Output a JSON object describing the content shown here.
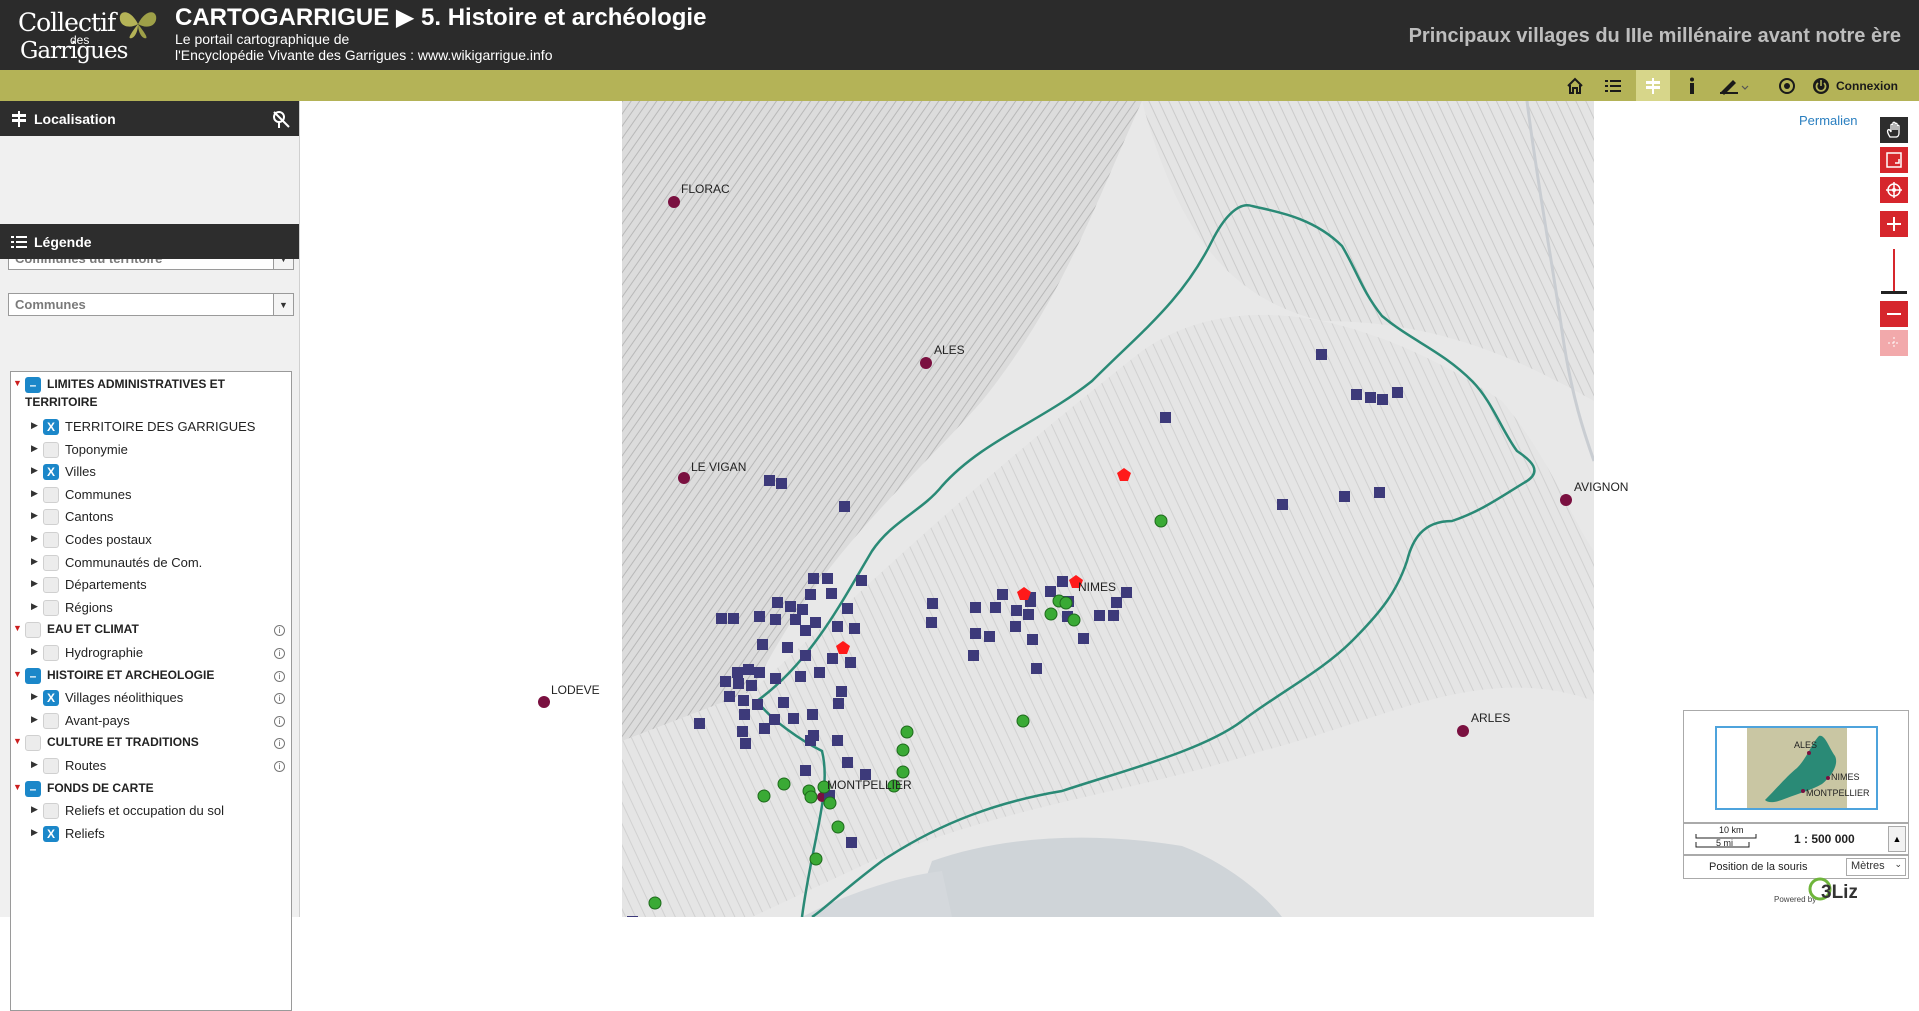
{
  "header": {
    "logo_line1": "Collectif",
    "logo_line2": "des",
    "logo_line3": "Garrigues",
    "title": "CARTOGARRIGUE ▶ 5. Histoire et archéologie",
    "subtitle1": "Le portail cartographique de",
    "subtitle2": "l'Encyclopédie Vivante des Garrigues : www.wikigarrigue.info",
    "map_title": "Principaux villages du IIIe millénaire avant notre ère"
  },
  "toolbar": {
    "connexion_label": "Connexion"
  },
  "localisation": {
    "title": "Localisation",
    "combo1": "Communes du territoire",
    "combo2": "Communes"
  },
  "legend": {
    "title": "Légende",
    "items": [
      {
        "label": "LIMITES ADMINISTRATIVES ET",
        "label2": "TERRITOIRE",
        "type": "group",
        "state": "minus"
      },
      {
        "label": "TERRITOIRE DES GARRIGUES",
        "type": "layer",
        "state": "x"
      },
      {
        "label": "Toponymie",
        "type": "layer",
        "state": "empty"
      },
      {
        "label": "Villes",
        "type": "layer",
        "state": "x"
      },
      {
        "label": "Communes",
        "type": "layer",
        "state": "empty"
      },
      {
        "label": "Cantons",
        "type": "layer",
        "state": "empty"
      },
      {
        "label": "Codes postaux",
        "type": "layer",
        "state": "empty"
      },
      {
        "label": "Communautés de Com.",
        "type": "layer",
        "state": "empty"
      },
      {
        "label": "Départements",
        "type": "layer",
        "state": "empty"
      },
      {
        "label": "Régions",
        "type": "layer",
        "state": "empty"
      },
      {
        "label": "EAU ET CLIMAT",
        "type": "group",
        "state": "empty"
      },
      {
        "label": "Hydrographie",
        "type": "layer",
        "state": "empty"
      },
      {
        "label": "HISTOIRE ET ARCHEOLOGIE",
        "type": "group",
        "state": "minus"
      },
      {
        "label": "Villages néolithiques",
        "type": "layer",
        "state": "x"
      },
      {
        "label": "Avant-pays",
        "type": "layer",
        "state": "empty"
      },
      {
        "label": "CULTURE ET TRADITIONS",
        "type": "group",
        "state": "empty"
      },
      {
        "label": "Routes",
        "type": "layer",
        "state": "empty"
      },
      {
        "label": "FONDS DE CARTE",
        "type": "group",
        "state": "minus"
      },
      {
        "label": "Reliefs et occupation du sol",
        "type": "layer",
        "state": "empty"
      },
      {
        "label": "Reliefs",
        "type": "layer",
        "state": "x"
      }
    ]
  },
  "map": {
    "permalien": "Permalien",
    "cities": {
      "florac": "FLORAC",
      "ales": "ALES",
      "le_vigan": "LE VIGAN",
      "avignon": "AVIGNON",
      "nimes": "NIMES",
      "lodeve": "LODEVE",
      "arles": "ARLES",
      "montpellier": "MONTPELLIER"
    },
    "overview": {
      "ales": "ALES",
      "nimes": "NIMES",
      "montpellier": "MONTPELLIER"
    },
    "scale": {
      "km": "10 km",
      "mi": "5 mi",
      "value": "1 : 500 000"
    },
    "mouse_position_label": "Position de la souris",
    "units": "Mètres",
    "powered_by": "Powered by"
  },
  "colors": {
    "header_bg": "#2b2b2b",
    "toolbar_bg": "#b4b357",
    "accent_red": "#d6262c",
    "checkbox_blue": "#1b87c9",
    "territory_line": "#2a8a76",
    "village_square": "#3d3a7a",
    "village_green": "#3aaa35",
    "city_dot": "#7a1040"
  }
}
